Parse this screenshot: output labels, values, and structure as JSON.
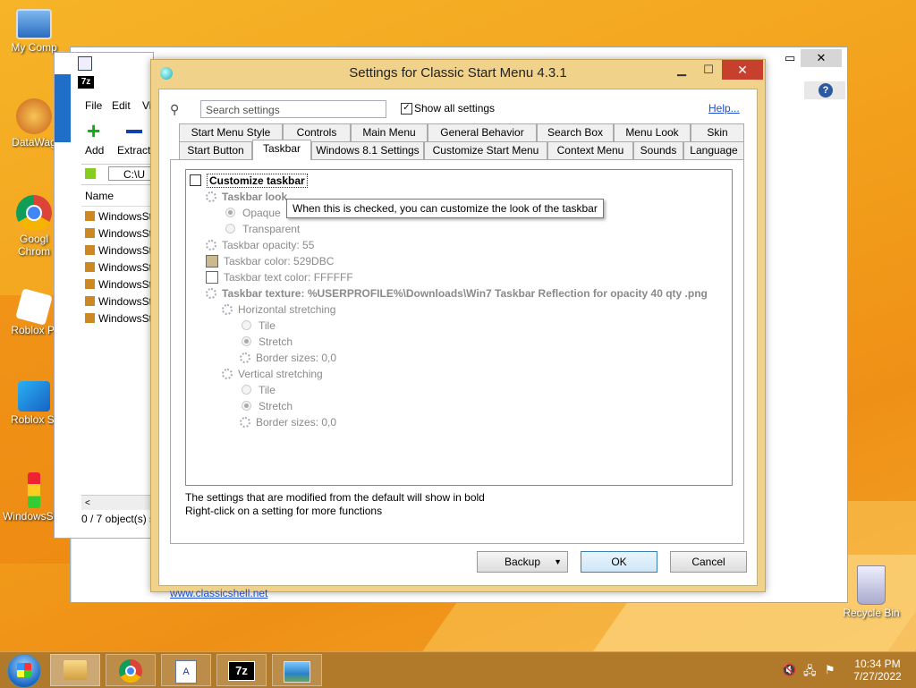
{
  "desktop": {
    "icons": [
      {
        "label": "My Comp"
      },
      {
        "label": "DataWag"
      },
      {
        "label": "Googl Chrom"
      },
      {
        "label": "Roblox Pl"
      },
      {
        "label": "Roblox St"
      },
      {
        "label": "WindowsSt..."
      }
    ],
    "recycle_bin": "Recycle Bin"
  },
  "bg_window": {
    "app_icon": "7z",
    "menu": [
      "File",
      "Edit",
      "Vi"
    ],
    "toolbar": {
      "add": "Add",
      "extract": "Extract"
    },
    "path": "C:\\U",
    "column_name": "Name",
    "files": [
      "WindowsSt",
      "WindowsSt",
      "WindowsSt",
      "WindowsSt",
      "WindowsSt",
      "WindowsSt",
      "WindowsSt"
    ],
    "status": "0 / 7 object(s) s"
  },
  "dialog": {
    "title": "Settings for Classic Start Menu 4.3.1",
    "search_placeholder": "Search settings",
    "show_all_label": "Show all settings",
    "help_link": "Help...",
    "tabs_row1": [
      "Start Menu Style",
      "Controls",
      "Main Menu",
      "General Behavior",
      "Search Box",
      "Menu Look",
      "Skin"
    ],
    "tabs_row2": [
      "Start Button",
      "Taskbar",
      "Windows 8.1 Settings",
      "Customize Start Menu",
      "Context Menu",
      "Sounds",
      "Language"
    ],
    "active_tab": "Taskbar",
    "settings": {
      "customize_taskbar": "Customize taskbar",
      "taskbar_look": "Taskbar look",
      "opaque": "Opaque",
      "transparent": "Transparent",
      "opacity": "Taskbar opacity: 55",
      "color": "Taskbar color: 529DBC",
      "text_color": "Taskbar text color: FFFFFF",
      "texture": "Taskbar texture: %USERPROFILE%\\Downloads\\Win7 Taskbar Reflection for opacity 40 qty .png",
      "horizontal": "Horizontal stretching",
      "h_tile": "Tile",
      "h_stretch": "Stretch",
      "h_border": "Border sizes: 0,0",
      "vertical": "Vertical stretching",
      "v_tile": "Tile",
      "v_stretch": "Stretch",
      "v_border": "Border sizes: 0,0"
    },
    "colors": {
      "taskbar_swatch": "#cdb98e",
      "text_swatch": "#ffffff"
    },
    "tooltip": "When this is checked, you can customize the look of the taskbar",
    "hint1": "The settings that are modified from the default will show in bold",
    "hint2": "Right-click on a setting for more functions",
    "site_link": "www.classicshell.net",
    "backup_btn": "Backup",
    "ok_btn": "OK",
    "cancel_btn": "Cancel"
  },
  "taskbar": {
    "time": "10:34 PM",
    "date": "7/27/2022"
  }
}
